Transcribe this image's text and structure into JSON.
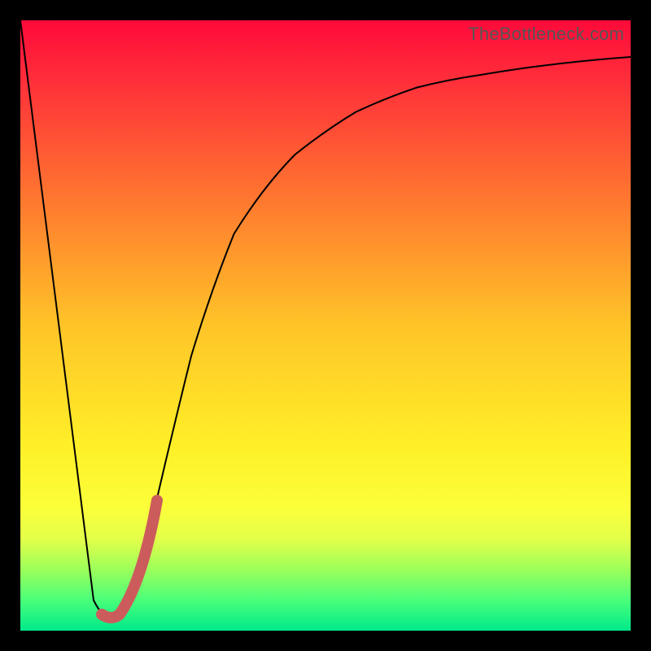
{
  "watermark": {
    "text": "TheBottleneck.com"
  },
  "colors": {
    "curve": "#000000",
    "highlight": "#cc5c5c",
    "frame": "#000000",
    "gradient_top": "#ff0a3a",
    "gradient_mid": "#fff028",
    "gradient_bottom": "#00e98a"
  },
  "chart_data": {
    "type": "line",
    "title": "",
    "xlabel": "",
    "ylabel": "",
    "xlim": [
      0,
      100
    ],
    "ylim": [
      0,
      100
    ],
    "grid": false,
    "legend_visible": false,
    "series": [
      {
        "name": "bottleneck-curve",
        "x": [
          0,
          12,
          15,
          18,
          22,
          28,
          35,
          45,
          55,
          65,
          75,
          85,
          100
        ],
        "values": [
          100,
          5,
          2,
          6,
          20,
          45,
          65,
          78,
          85,
          89,
          91,
          92.5,
          94
        ]
      },
      {
        "name": "highlight-segment",
        "x": [
          12,
          15,
          18
        ],
        "values": [
          5,
          2,
          20
        ]
      }
    ],
    "annotations": [
      {
        "text": "TheBottleneck.com",
        "position": "top-right"
      }
    ]
  }
}
